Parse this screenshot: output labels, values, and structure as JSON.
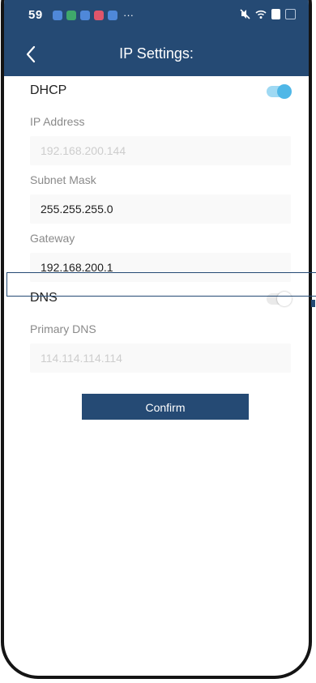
{
  "status_bar": {
    "time": "59",
    "notif_more": "···",
    "notif_colors": [
      "#4f88d9",
      "#3fa86b",
      "#4f88d9",
      "#e0556a",
      "#4f88d9"
    ]
  },
  "header": {
    "title": "IP Settings:"
  },
  "dhcp": {
    "label": "DHCP",
    "enabled": true
  },
  "fields_top": {
    "ip_address": {
      "label": "IP Address",
      "value": "192.168.200.144",
      "disabled": true
    },
    "subnet_mask": {
      "label": "Subnet Mask",
      "value": "255.255.255.0",
      "disabled": false
    },
    "gateway": {
      "label": "Gateway",
      "value": "192.168.200.1",
      "disabled": false
    }
  },
  "dns": {
    "label": "DNS",
    "enabled": false,
    "primary": {
      "label": "Primary DNS",
      "value": "114.114.114.114",
      "disabled": true
    }
  },
  "actions": {
    "confirm_label": "Confirm"
  },
  "colors": {
    "primary": "#254a74",
    "toggle_on": "#4fb7e7",
    "disabled_text": "#cdcdcd"
  }
}
